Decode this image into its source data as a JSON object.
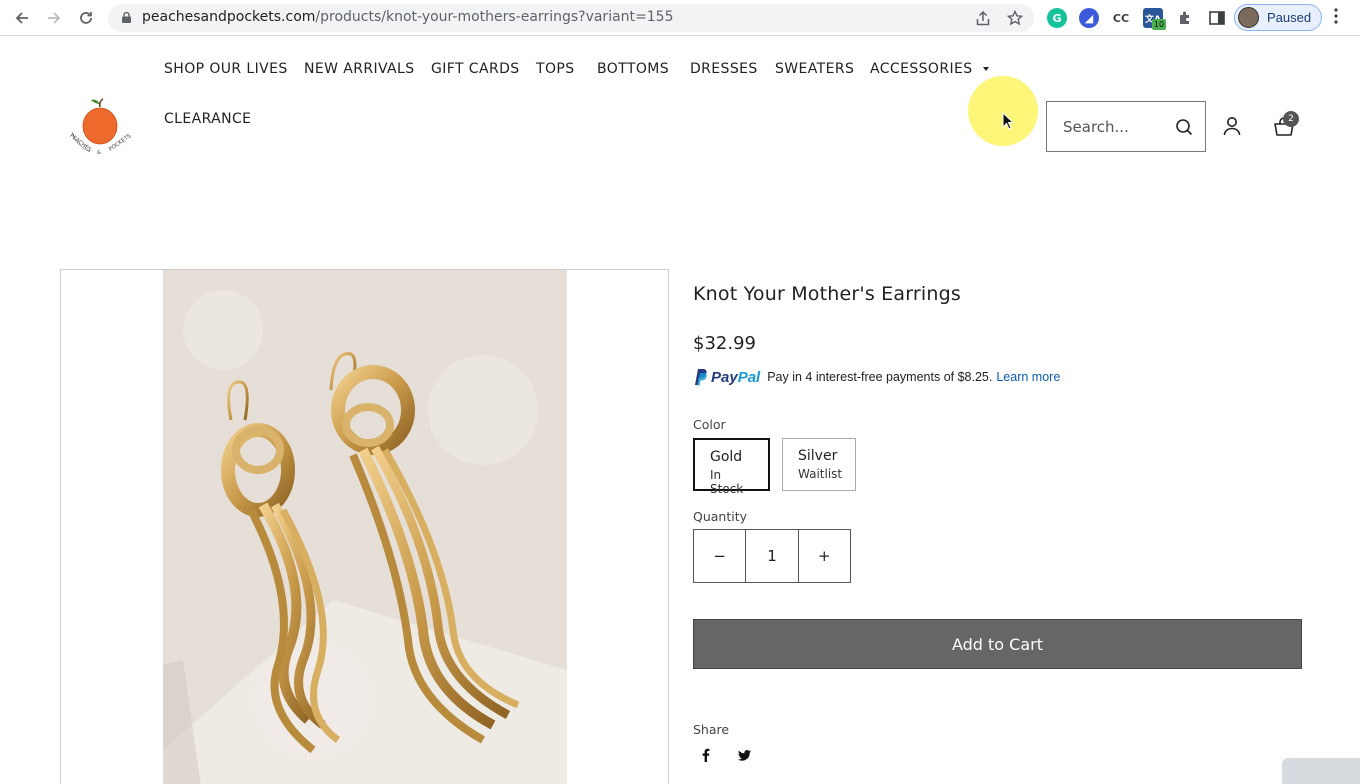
{
  "browser": {
    "url_domain": "peachesandpockets.com",
    "url_path": "/products/knot-your-mothers-earrings?variant=155",
    "profile_status": "Paused",
    "extension_badge": "10",
    "extensions": [
      "grammarly-icon",
      "arc-icon",
      "cc-icon",
      "translate-icon",
      "puzzle-icon"
    ]
  },
  "header": {
    "nav": [
      "SHOP OUR LIVES",
      "NEW ARRIVALS",
      "GIFT CARDS",
      "TOPS",
      "BOTTOMS",
      "DRESSES",
      "SWEATERS",
      "ACCESSORIES",
      "CLEARANCE"
    ],
    "search_placeholder": "Search...",
    "cart_count": "2",
    "logo_text": "PEACHES & POCKETS"
  },
  "product": {
    "title": "Knot Your Mother's Earrings",
    "price": "$32.99",
    "paypal": {
      "brand_pay": "Pay",
      "brand_pal": "Pal",
      "message": "Pay in 4 interest-free payments of $8.25.",
      "link": "Learn more"
    },
    "color_label": "Color",
    "colors": [
      {
        "name": "Gold",
        "status": "In Stock"
      },
      {
        "name": "Silver",
        "status": "Waitlist"
      }
    ],
    "quantity_label": "Quantity",
    "quantity": {
      "minus": "−",
      "value": "1",
      "plus": "+"
    },
    "add_to_cart": "Add to Cart",
    "share_label": "Share"
  },
  "colors": {
    "button": "#666666",
    "paypal_dark": "#253b80",
    "paypal_light": "#179bd7",
    "link": "#0a5bb0",
    "cursor_highlight": "#fdf56a"
  }
}
